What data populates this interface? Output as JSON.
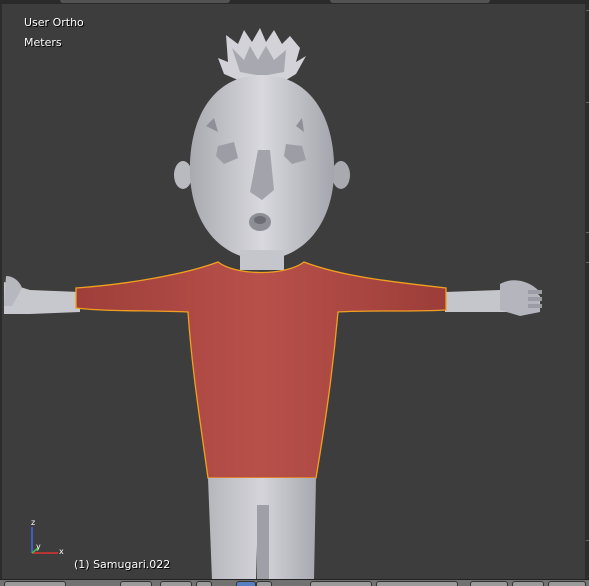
{
  "viewport": {
    "view_label": "User Ortho",
    "units_label": "Meters",
    "object_label": "(1) Samugari.022"
  },
  "axes": {
    "z": "z",
    "y": "y",
    "x": "x"
  },
  "colors": {
    "background": "#3d3d3d",
    "shirt": "#b04a44",
    "selection_outline": "#f2a020",
    "mesh": "#c9c9cf",
    "axis_x": "#dd3333",
    "axis_y": "#44bb44",
    "axis_z": "#4466ee"
  }
}
